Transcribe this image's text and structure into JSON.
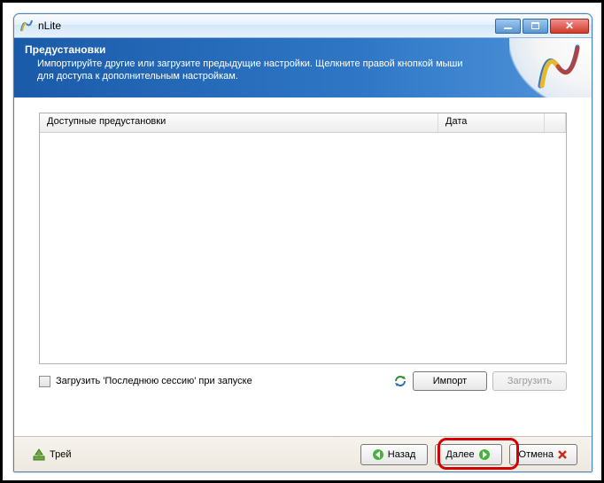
{
  "window": {
    "title": "nLite"
  },
  "header": {
    "title": "Предустановки",
    "subtitle": "Импортируйте другие или загрузите предыдущие настройки. Щелкните правой кнопкой мыши для доступа к дополнительным настройкам."
  },
  "list": {
    "col_name": "Доступные предустановки",
    "col_date": "Дата"
  },
  "options": {
    "load_last_session": "Загрузить 'Последнюю сессию' при запуске"
  },
  "buttons": {
    "import": "Импорт",
    "load": "Загрузить",
    "tray": "Трей",
    "back": "Назад",
    "next": "Далее",
    "cancel": "Отмена"
  }
}
